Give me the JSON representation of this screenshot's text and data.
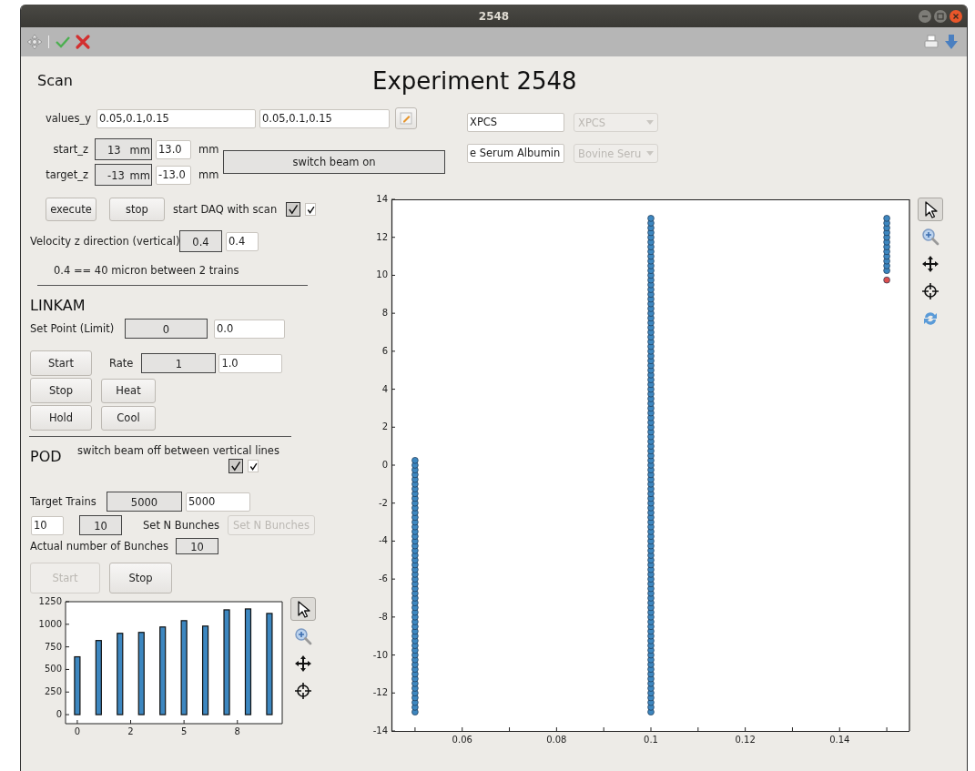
{
  "window": {
    "title": "2548"
  },
  "heading": "Experiment 2548",
  "scan": {
    "title": "Scan",
    "values_y": {
      "label": "values_y",
      "fields": [
        "0.05,0.1,0.15",
        "0.05,0.1,0.15"
      ]
    },
    "z_rows": [
      {
        "label": "start_z",
        "readout": "13",
        "readout_unit": "mm",
        "value": "13.0",
        "unit": "mm"
      },
      {
        "label": "target_z",
        "readout": "-13",
        "readout_unit": "mm",
        "value": "-13.0",
        "unit": "mm"
      }
    ],
    "beam_button": {
      "label": "switch beam on"
    },
    "buttons": [
      {
        "label": "execute"
      },
      {
        "label": "stop"
      }
    ],
    "daq": {
      "label": "start DAQ with scan",
      "checkboxes": [
        {
          "kind": "framed",
          "checked": true
        },
        {
          "kind": "plain",
          "checked": true
        }
      ]
    },
    "velocity": {
      "label": "Velocity z direction (vertical)",
      "readout": "0.4",
      "value": "0.4"
    },
    "note": "0.4 == 40 micron between 2 trains"
  },
  "sample": {
    "rows": [
      {
        "value": "XPCS",
        "combo": "XPCS",
        "disabled": true
      },
      {
        "value": "e Serum Albumin",
        "combo": "Bovine Seru",
        "disabled": true
      }
    ]
  },
  "linkam": {
    "title": "LINKAM",
    "set_point": {
      "label": "Set Point (Limit)",
      "readout": "0",
      "value": "0.0"
    },
    "rate": {
      "label": "Rate",
      "readout": "1",
      "value": "1.0"
    },
    "buttons": [
      {
        "label": "Start"
      },
      {
        "label": "Stop"
      },
      {
        "label": "Hold"
      },
      {
        "label": "Heat"
      },
      {
        "label": "Cool"
      }
    ]
  },
  "pod": {
    "title": "POD",
    "beam_off": {
      "label": "switch beam off between vertical lines",
      "checkboxes": [
        {
          "kind": "framed",
          "checked": true
        },
        {
          "kind": "plain",
          "checked": true
        }
      ]
    },
    "target_trains": {
      "label": "Target Trains",
      "readout": "5000",
      "value": "5000"
    },
    "bunches": {
      "value": "10",
      "readout": "10",
      "label": "Set N Bunches",
      "button": {
        "label": "Set N Bunches",
        "disabled": true
      }
    },
    "actual": {
      "label": "Actual number of Bunches",
      "readout": "10"
    },
    "buttons": [
      {
        "label": "Start",
        "disabled": true
      },
      {
        "label": "Stop",
        "disabled": false
      }
    ],
    "chart": {
      "tools": [
        {
          "kind": "pointer",
          "selected": true
        },
        {
          "kind": "zoom",
          "selected": false
        },
        {
          "kind": "pan",
          "selected": false
        },
        {
          "kind": "crosshair",
          "selected": false
        }
      ],
      "chart_data": {
        "type": "bar",
        "xlim": [
          -0.55,
          9.6
        ],
        "ylim": [
          -100,
          1250
        ],
        "xticks": [
          {
            "value": 0,
            "label": "0"
          },
          {
            "value": 2.5,
            "label": "2"
          },
          {
            "value": 5,
            "label": "5"
          },
          {
            "value": 7.5,
            "label": "8"
          }
        ],
        "yticks": [
          {
            "value": 0,
            "label": "0"
          },
          {
            "value": 250,
            "label": "250"
          },
          {
            "value": 500,
            "label": "500"
          },
          {
            "value": 750,
            "label": "750"
          },
          {
            "value": 1000,
            "label": "1000"
          },
          {
            "value": 1250,
            "label": "1250"
          }
        ],
        "x": [
          0,
          1,
          2,
          3,
          4,
          5,
          6,
          7,
          8,
          9
        ],
        "series": [
          {
            "color": "#3d87c0",
            "values": [
              640,
              820,
              900,
              910,
              970,
              1040,
              980,
              1160,
              1170,
              1120
            ]
          }
        ]
      }
    }
  },
  "scan_plot": {
    "tools": [
      {
        "kind": "pointer",
        "selected": true
      },
      {
        "kind": "zoom",
        "selected": false
      },
      {
        "kind": "pan",
        "selected": false
      },
      {
        "kind": "crosshair",
        "selected": false
      },
      {
        "kind": "refresh",
        "selected": false
      }
    ],
    "chart_data": {
      "type": "scatter",
      "xlim": [
        0.045,
        0.155
      ],
      "ylim": [
        -14,
        14
      ],
      "xticks": [
        {
          "value": 0.06,
          "label": "0.06"
        },
        {
          "value": 0.08,
          "label": "0.08"
        },
        {
          "value": 0.1,
          "label": "0.1"
        },
        {
          "value": 0.12,
          "label": "0.12"
        },
        {
          "value": 0.14,
          "label": "0.14"
        }
      ],
      "yticks": [
        {
          "value": -14,
          "label": "-14"
        },
        {
          "value": -12,
          "label": "-12"
        },
        {
          "value": -10,
          "label": "-10"
        },
        {
          "value": -8,
          "label": "-8"
        },
        {
          "value": -6,
          "label": "-6"
        },
        {
          "value": -4,
          "label": "-4"
        },
        {
          "value": -2,
          "label": "-2"
        },
        {
          "value": 0,
          "label": "0"
        },
        {
          "value": 2,
          "label": "2"
        },
        {
          "value": 4,
          "label": "4"
        },
        {
          "value": 6,
          "label": "6"
        },
        {
          "value": 8,
          "label": "8"
        },
        {
          "value": 10,
          "label": "10"
        },
        {
          "value": 12,
          "label": "12"
        },
        {
          "value": 14,
          "label": "14"
        }
      ],
      "series": [
        {
          "color": "#3d87c0",
          "x": [
            0.05,
            0.05,
            0.05,
            0.05,
            0.05,
            0.05,
            0.05,
            0.05,
            0.05,
            0.05,
            0.05,
            0.05,
            0.05,
            0.05,
            0.05,
            0.05,
            0.05,
            0.05,
            0.05,
            0.05,
            0.05,
            0.05,
            0.05,
            0.05,
            0.05,
            0.05,
            0.05,
            0.05,
            0.05,
            0.05,
            0.05,
            0.05,
            0.05,
            0.05,
            0.05,
            0.05,
            0.05,
            0.05,
            0.05,
            0.05,
            0.05,
            0.05,
            0.05,
            0.05,
            0.05,
            0.05,
            0.05,
            0.05,
            0.05,
            0.05,
            0.05,
            0.05,
            0.05,
            0.05
          ],
          "values": [
            -13,
            -12.75,
            -12.5,
            -12.25,
            -12,
            -11.75,
            -11.5,
            -11.25,
            -11,
            -10.75,
            -10.5,
            -10.25,
            -10,
            -9.75,
            -9.5,
            -9.25,
            -9,
            -8.75,
            -8.5,
            -8.25,
            -8,
            -7.75,
            -7.5,
            -7.25,
            -7,
            -6.75,
            -6.5,
            -6.25,
            -6,
            -5.75,
            -5.5,
            -5.25,
            -5,
            -4.75,
            -4.5,
            -4.25,
            -4,
            -3.75,
            -3.5,
            -3.25,
            -3,
            -2.75,
            -2.5,
            -2.25,
            -2,
            -1.75,
            -1.5,
            -1.25,
            -1,
            -0.75,
            -0.5,
            -0.25,
            0,
            0.25
          ]
        },
        {
          "color": "#3d87c0",
          "x": [
            0.1,
            0.1,
            0.1,
            0.1,
            0.1,
            0.1,
            0.1,
            0.1,
            0.1,
            0.1,
            0.1,
            0.1,
            0.1,
            0.1,
            0.1,
            0.1,
            0.1,
            0.1,
            0.1,
            0.1,
            0.1,
            0.1,
            0.1,
            0.1,
            0.1,
            0.1,
            0.1,
            0.1,
            0.1,
            0.1,
            0.1,
            0.1,
            0.1,
            0.1,
            0.1,
            0.1,
            0.1,
            0.1,
            0.1,
            0.1,
            0.1,
            0.1,
            0.1,
            0.1,
            0.1,
            0.1,
            0.1,
            0.1,
            0.1,
            0.1,
            0.1,
            0.1,
            0.1,
            0.1,
            0.1,
            0.1,
            0.1,
            0.1,
            0.1,
            0.1,
            0.1,
            0.1,
            0.1,
            0.1,
            0.1,
            0.1,
            0.1,
            0.1,
            0.1,
            0.1,
            0.1,
            0.1,
            0.1,
            0.1,
            0.1,
            0.1,
            0.1,
            0.1,
            0.1,
            0.1,
            0.1,
            0.1,
            0.1,
            0.1,
            0.1,
            0.1,
            0.1,
            0.1,
            0.1,
            0.1,
            0.1,
            0.1,
            0.1,
            0.1,
            0.1,
            0.1,
            0.1,
            0.1,
            0.1,
            0.1,
            0.1,
            0.1,
            0.1,
            0.1,
            0.1
          ],
          "values": [
            -13,
            -12.75,
            -12.5,
            -12.25,
            -12,
            -11.75,
            -11.5,
            -11.25,
            -11,
            -10.75,
            -10.5,
            -10.25,
            -10,
            -9.75,
            -9.5,
            -9.25,
            -9,
            -8.75,
            -8.5,
            -8.25,
            -8,
            -7.75,
            -7.5,
            -7.25,
            -7,
            -6.75,
            -6.5,
            -6.25,
            -6,
            -5.75,
            -5.5,
            -5.25,
            -5,
            -4.75,
            -4.5,
            -4.25,
            -4,
            -3.75,
            -3.5,
            -3.25,
            -3,
            -2.75,
            -2.5,
            -2.25,
            -2,
            -1.75,
            -1.5,
            -1.25,
            -1,
            -0.75,
            -0.5,
            -0.25,
            0,
            0.25,
            0.5,
            0.75,
            1,
            1.25,
            1.5,
            1.75,
            2,
            2.25,
            2.5,
            2.75,
            3,
            3.25,
            3.5,
            3.75,
            4,
            4.25,
            4.5,
            4.75,
            5,
            5.25,
            5.5,
            5.75,
            6,
            6.25,
            6.5,
            6.75,
            7,
            7.25,
            7.5,
            7.75,
            8,
            8.25,
            8.5,
            8.75,
            9,
            9.25,
            9.5,
            9.75,
            10,
            10.25,
            10.5,
            10.75,
            11,
            11.25,
            11.5,
            11.75,
            12,
            12.25,
            12.5,
            12.75,
            13
          ]
        },
        {
          "color": "#3d87c0",
          "x": [
            0.15,
            0.15,
            0.15,
            0.15,
            0.15,
            0.15,
            0.15,
            0.15,
            0.15,
            0.15,
            0.15,
            0.15
          ],
          "values": [
            10.25,
            10.5,
            10.75,
            11,
            11.25,
            11.5,
            11.75,
            12,
            12.25,
            12.5,
            12.75,
            13
          ]
        },
        {
          "color": "#dd4f4f",
          "x": [
            0.15
          ],
          "values": [
            9.75
          ]
        }
      ]
    }
  }
}
